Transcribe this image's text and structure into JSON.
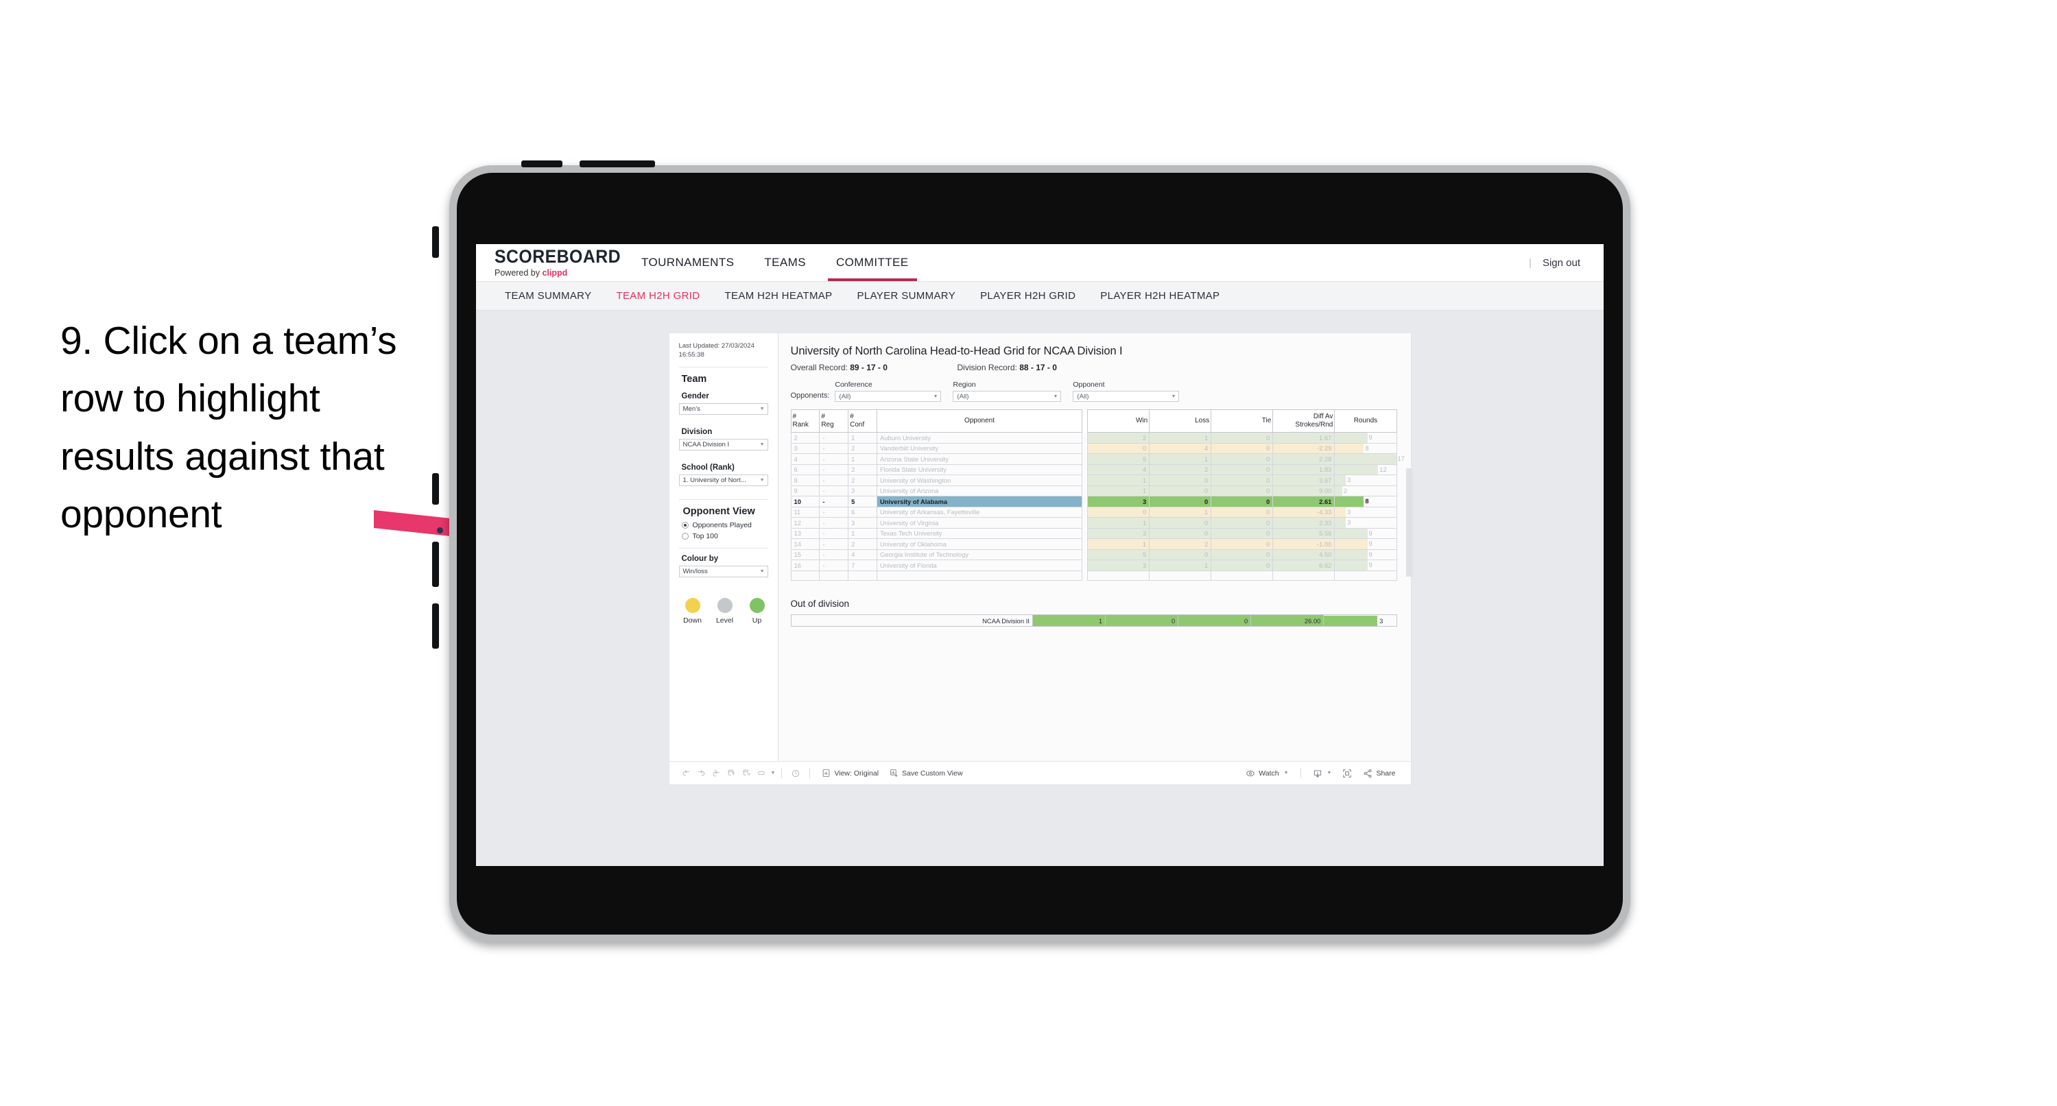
{
  "annotation": {
    "text": "9. Click on a team’s row to highlight results against that opponent",
    "arrow_color": "#e8376a"
  },
  "topnav": {
    "brand_name": "SCOREBOARD",
    "brand_sub_prefix": "Powered by ",
    "brand_sub_brand": "clippd",
    "items": [
      {
        "label": "TOURNAMENTS",
        "active": false
      },
      {
        "label": "TEAMS",
        "active": false
      },
      {
        "label": "COMMITTEE",
        "active": true
      }
    ],
    "divider": "|",
    "sign_out": "Sign out",
    "accent": "#b52a52"
  },
  "subnav": {
    "items": [
      {
        "label": "TEAM SUMMARY",
        "active": false
      },
      {
        "label": "TEAM H2H GRID",
        "active": true
      },
      {
        "label": "TEAM H2H HEATMAP",
        "active": false
      },
      {
        "label": "PLAYER SUMMARY",
        "active": false
      },
      {
        "label": "PLAYER H2H GRID",
        "active": false
      },
      {
        "label": "PLAYER H2H HEATMAP",
        "active": false
      }
    ],
    "accent": "#e4305f"
  },
  "sidebar": {
    "last_updated": "Last Updated: 27/03/2024 16:55:38",
    "team_title": "Team",
    "gender_label": "Gender",
    "gender_value": "Men’s",
    "division_label": "Division",
    "division_value": "NCAA Division I",
    "school_label": "School (Rank)",
    "school_value": "1. University of Nort...",
    "opponent_view_title": "Opponent View",
    "opponent_options": [
      {
        "label": "Opponents Played",
        "selected": true
      },
      {
        "label": "Top 100",
        "selected": false
      }
    ],
    "colour_by_label": "Colour by",
    "colour_by_value": "Win/loss",
    "legend": [
      {
        "label": "Down",
        "color": "#f2d14e"
      },
      {
        "label": "Level",
        "color": "#c4c7cb"
      },
      {
        "label": "Up",
        "color": "#7ec465"
      }
    ]
  },
  "main": {
    "title": "University of North Carolina Head-to-Head Grid for NCAA Division I",
    "overall_record_label": "Overall Record: ",
    "overall_record_value": "89 - 17 - 0",
    "division_record_label": "Division Record: ",
    "division_record_value": "88 - 17 - 0",
    "opponents_label": "Opponents:",
    "filters": [
      {
        "label": "Conference",
        "value": "(All)"
      },
      {
        "label": "Region",
        "value": "(All)"
      },
      {
        "label": "Opponent",
        "value": "(All)"
      }
    ],
    "table": {
      "headers": [
        "# Rank",
        "# Reg",
        "# Conf",
        "Opponent",
        "Win",
        "Loss",
        "Tie",
        "Diff Av Strokes/Rnd",
        "Rounds"
      ],
      "header_lines": [
        [
          "#",
          "Rank"
        ],
        [
          "#",
          "Reg"
        ],
        [
          "#",
          "Conf"
        ],
        [
          "Opponent"
        ],
        [
          "Win"
        ],
        [
          "Loss"
        ],
        [
          "Tie"
        ],
        [
          "Diff Av",
          "Strokes/Rnd"
        ],
        [
          "Rounds"
        ]
      ],
      "rows": [
        {
          "rank": "2",
          "reg": "-",
          "conf": "1",
          "opponent": "Auburn University",
          "win": "2",
          "loss": "1",
          "tie": "0",
          "diff": "1.67",
          "rounds": "9",
          "color": "up",
          "highlighted": false
        },
        {
          "rank": "3",
          "reg": "-",
          "conf": "2",
          "opponent": "Vanderbilt University",
          "win": "0",
          "loss": "4",
          "tie": "0",
          "diff": "-2.29",
          "rounds": "8",
          "color": "down",
          "highlighted": false
        },
        {
          "rank": "4",
          "reg": "-",
          "conf": "1",
          "opponent": "Arizona State University",
          "win": "5",
          "loss": "1",
          "tie": "0",
          "diff": "2.28",
          "rounds": "17",
          "color": "up",
          "highlighted": false
        },
        {
          "rank": "6",
          "reg": "-",
          "conf": "2",
          "opponent": "Florida State University",
          "win": "4",
          "loss": "2",
          "tie": "0",
          "diff": "1.83",
          "rounds": "12",
          "color": "up",
          "highlighted": false
        },
        {
          "rank": "8",
          "reg": "-",
          "conf": "2",
          "opponent": "University of Washington",
          "win": "1",
          "loss": "0",
          "tie": "0",
          "diff": "3.67",
          "rounds": "3",
          "color": "up",
          "highlighted": false
        },
        {
          "rank": "9",
          "reg": "-",
          "conf": "3",
          "opponent": "University of Arizona",
          "win": "1",
          "loss": "0",
          "tie": "0",
          "diff": "9.00",
          "rounds": "2",
          "color": "up",
          "highlighted": false
        },
        {
          "rank": "10",
          "reg": "-",
          "conf": "5",
          "opponent": "University of Alabama",
          "win": "3",
          "loss": "0",
          "tie": "0",
          "diff": "2.61",
          "rounds": "8",
          "color": "up",
          "highlighted": true
        },
        {
          "rank": "11",
          "reg": "-",
          "conf": "6",
          "opponent": "University of Arkansas, Fayetteville",
          "win": "0",
          "loss": "1",
          "tie": "0",
          "diff": "-4.33",
          "rounds": "3",
          "color": "down",
          "highlighted": false
        },
        {
          "rank": "12",
          "reg": "-",
          "conf": "3",
          "opponent": "University of Virginia",
          "win": "1",
          "loss": "0",
          "tie": "0",
          "diff": "2.33",
          "rounds": "3",
          "color": "up",
          "highlighted": false
        },
        {
          "rank": "13",
          "reg": "-",
          "conf": "1",
          "opponent": "Texas Tech University",
          "win": "3",
          "loss": "0",
          "tie": "0",
          "diff": "5.56",
          "rounds": "9",
          "color": "up",
          "highlighted": false
        },
        {
          "rank": "14",
          "reg": "-",
          "conf": "2",
          "opponent": "University of Oklahoma",
          "win": "1",
          "loss": "2",
          "tie": "0",
          "diff": "-1.00",
          "rounds": "9",
          "color": "down",
          "highlighted": false
        },
        {
          "rank": "15",
          "reg": "-",
          "conf": "4",
          "opponent": "Georgia Institute of Technology",
          "win": "5",
          "loss": "0",
          "tie": "0",
          "diff": "4.50",
          "rounds": "9",
          "color": "up",
          "highlighted": false
        },
        {
          "rank": "16",
          "reg": "-",
          "conf": "7",
          "opponent": "University of Florida",
          "win": "3",
          "loss": "1",
          "tie": "0",
          "diff": "6.62",
          "rounds": "9",
          "color": "up",
          "highlighted": false
        }
      ]
    },
    "out_of_division": {
      "title": "Out of division",
      "row": {
        "opponent": "NCAA Division II",
        "win": "1",
        "loss": "0",
        "tie": "0",
        "diff": "26.00",
        "rounds": "3"
      }
    }
  },
  "toolbar": {
    "icons": [
      "undo-icon",
      "redo-icon",
      "revert-icon",
      "refresh-data-icon",
      "pause-updates-icon",
      "view-original-toggle-icon"
    ],
    "alert_icon": "alerts-icon",
    "view_label": "View: Original",
    "save_label": "Save Custom View",
    "watch_label": "Watch",
    "download_icon": "download-icon",
    "fullscreen_icon": "fullscreen-icon",
    "share_label": "Share"
  },
  "chart_data": {
    "type": "table",
    "title": "University of North Carolina Head-to-Head Grid for NCAA Division I",
    "columns": [
      "# Rank",
      "# Reg",
      "# Conf",
      "Opponent",
      "Win",
      "Loss",
      "Tie",
      "Diff Av Strokes/Rnd",
      "Rounds"
    ],
    "colour_by": "Win/loss",
    "colour_scale": {
      "Down": "#f7e9c2",
      "Level": "#e3e5e4",
      "Up": "#dde9d5",
      "Up-selected": "#7ec465",
      "selected-row": "#82b3c9"
    },
    "rounds_axis_max": 17,
    "rows": [
      [
        "2",
        "-",
        "1",
        "Auburn University",
        2,
        1,
        0,
        1.67,
        9
      ],
      [
        "3",
        "-",
        "2",
        "Vanderbilt University",
        0,
        4,
        0,
        -2.29,
        8
      ],
      [
        "4",
        "-",
        "1",
        "Arizona State University",
        5,
        1,
        0,
        2.28,
        17
      ],
      [
        "6",
        "-",
        "2",
        "Florida State University",
        4,
        2,
        0,
        1.83,
        12
      ],
      [
        "8",
        "-",
        "2",
        "University of Washington",
        1,
        0,
        0,
        3.67,
        3
      ],
      [
        "9",
        "-",
        "3",
        "University of Arizona",
        1,
        0,
        0,
        9.0,
        2
      ],
      [
        "10",
        "-",
        "5",
        "University of Alabama",
        3,
        0,
        0,
        2.61,
        8
      ],
      [
        "11",
        "-",
        "6",
        "University of Arkansas, Fayetteville",
        0,
        1,
        0,
        -4.33,
        3
      ],
      [
        "12",
        "-",
        "3",
        "University of Virginia",
        1,
        0,
        0,
        2.33,
        3
      ],
      [
        "13",
        "-",
        "1",
        "Texas Tech University",
        3,
        0,
        0,
        5.56,
        9
      ],
      [
        "14",
        "-",
        "2",
        "University of Oklahoma",
        1,
        2,
        0,
        -1.0,
        9
      ],
      [
        "15",
        "-",
        "4",
        "Georgia Institute of Technology",
        5,
        0,
        0,
        4.5,
        9
      ],
      [
        "16",
        "-",
        "7",
        "University of Florida",
        3,
        1,
        0,
        6.62,
        9
      ]
    ],
    "out_of_division": [
      [
        "NCAA Division II",
        1,
        0,
        0,
        26.0,
        3
      ]
    ],
    "summary": {
      "overall_record": "89 - 17 - 0",
      "division_record": "88 - 17 - 0"
    }
  }
}
